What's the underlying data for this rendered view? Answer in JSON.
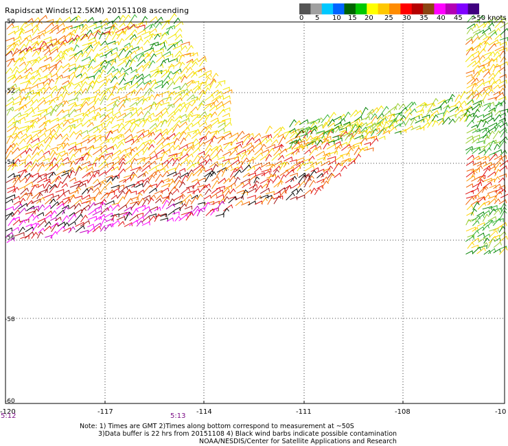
{
  "title": "Rapidscat Winds(12.5KM) 20151108 ascending",
  "colorbar": {
    "labels": [
      "0",
      "5",
      "10",
      "15",
      "20",
      "25",
      "30",
      "35",
      "40",
      "45",
      ">50 knots"
    ],
    "colors": [
      "#555555",
      "#a0a0a0",
      "#00c8ff",
      "#0064ff",
      "#006400",
      "#00c800",
      "#ffff00",
      "#ffc800",
      "#ff8c00",
      "#ff0000",
      "#b40000",
      "#8b4513",
      "#ff00ff",
      "#b400b4",
      "#8000ff",
      "#400080"
    ]
  },
  "axes": {
    "lon_labels": [
      "-120",
      "-117",
      "-114",
      "-111",
      "-108",
      "-10"
    ],
    "lat_labels": [
      "-50",
      "-52",
      "-54",
      "-56",
      "-58",
      "-60"
    ]
  },
  "times": [
    "5:12",
    "5:13"
  ],
  "notes": {
    "line1": "Note: 1) Times are GMT 2)Times along bottom correspond to measurement at ~50S",
    "line2": "3)Data buffer is 22 hrs from 20151108 4) Black wind barbs indicate possible contamination",
    "line3": "NOAA/NESDIS/Center for Satellite Applications and Research"
  }
}
